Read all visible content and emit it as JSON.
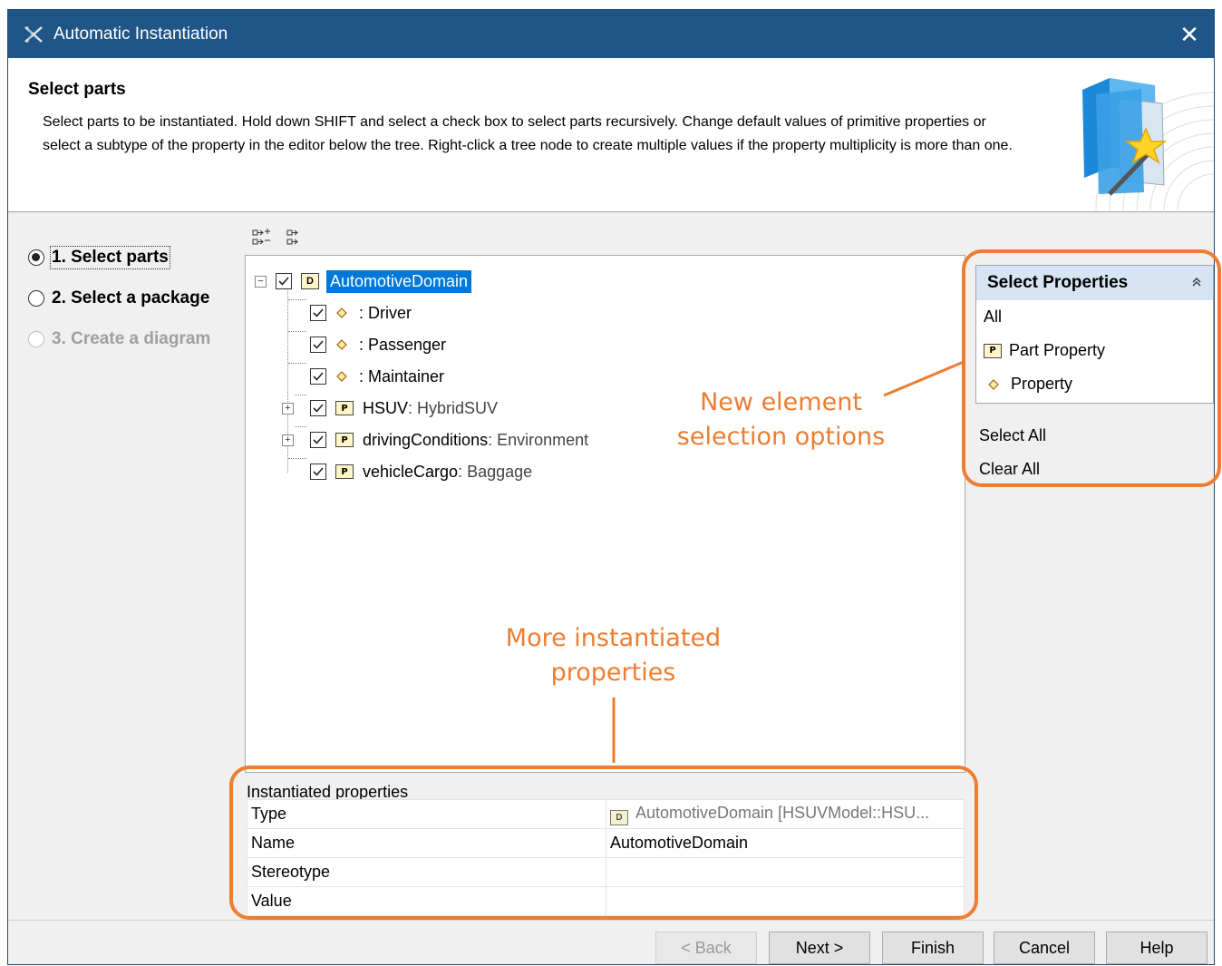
{
  "window": {
    "title": "Automatic Instantiation",
    "close_label": "✕"
  },
  "header": {
    "title": "Select parts",
    "description": "Select parts to be instantiated. Hold down SHIFT and select a check box to select parts recursively. Change default values of primitive properties or select a subtype of the property in the editor below the tree. Right-click a tree node to create multiple values if the property multiplicity is more than one."
  },
  "steps": [
    {
      "label": "1. Select parts",
      "state": "selected"
    },
    {
      "label": "2. Select a package",
      "state": "enabled"
    },
    {
      "label": "3. Create a diagram",
      "state": "disabled"
    }
  ],
  "toolbar": {
    "expand_icon": "expand-all-icon",
    "collapse_icon": "collapse-all-icon"
  },
  "tree": {
    "root": {
      "name": "AutomotiveDomain",
      "checked": true,
      "expanded": true,
      "icon": "domain-block-icon"
    },
    "children": [
      {
        "name": ": Driver",
        "type": "",
        "checked": true,
        "icon": "property-icon",
        "expandable": false
      },
      {
        "name": ": Passenger",
        "type": "",
        "checked": true,
        "icon": "property-icon",
        "expandable": false
      },
      {
        "name": ": Maintainer",
        "type": "",
        "checked": true,
        "icon": "property-icon",
        "expandable": false
      },
      {
        "name": "HSUV",
        "type": " : HybridSUV",
        "checked": true,
        "icon": "part-property-icon",
        "expandable": true
      },
      {
        "name": "drivingConditions",
        "type": " : Environment",
        "checked": true,
        "icon": "part-property-icon",
        "expandable": true
      },
      {
        "name": "vehicleCargo",
        "type": " : Baggage",
        "checked": true,
        "icon": "part-property-icon",
        "expandable": false
      }
    ]
  },
  "instantiated_properties": {
    "title": "Instantiated properties",
    "rows": [
      {
        "key": "Type",
        "value": "AutomotiveDomain [HSUVModel::HSU..."
      },
      {
        "key": "Name",
        "value": "AutomotiveDomain"
      },
      {
        "key": "Stereotype",
        "value": ""
      },
      {
        "key": "Value",
        "value": ""
      }
    ]
  },
  "select_properties": {
    "title": "Select Properties",
    "items": [
      {
        "label": "All",
        "icon": ""
      },
      {
        "label": "Part Property",
        "icon": "part-property-icon"
      },
      {
        "label": "Property",
        "icon": "property-icon"
      }
    ],
    "select_all": "Select All",
    "clear_all": "Clear All"
  },
  "annotations": {
    "new_options_line1": "New element",
    "new_options_line2": "selection options",
    "more_props_line1": "More instantiated",
    "more_props_line2": "properties"
  },
  "buttons": {
    "back": "< Back",
    "next": "Next >",
    "finish": "Finish",
    "cancel": "Cancel",
    "help": "Help"
  },
  "colors": {
    "titlebar": "#1f5587",
    "selection": "#0078d7",
    "annotation": "#ed7d31",
    "panel_header": "#d6e4f3"
  }
}
